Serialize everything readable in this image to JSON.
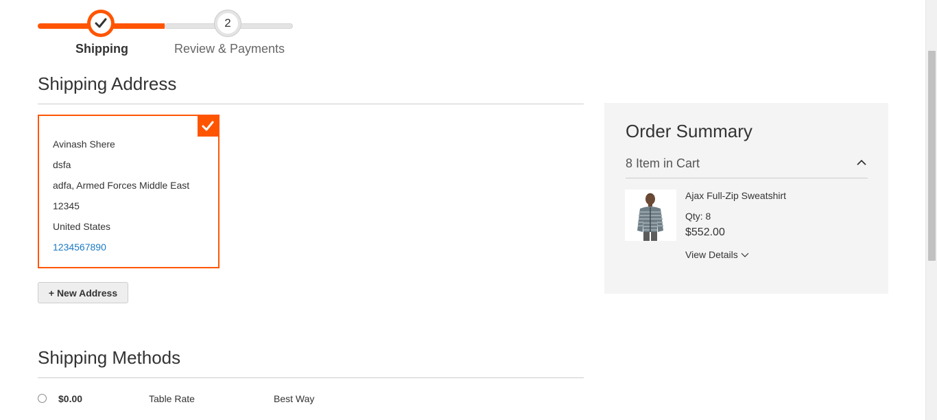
{
  "progress": {
    "steps": [
      {
        "number": "1",
        "label": "Shipping",
        "state": "complete"
      },
      {
        "number": "2",
        "label": "Review & Payments",
        "state": "pending"
      }
    ],
    "active_color": "#ff5501",
    "check_icon": "checkmark-icon"
  },
  "shipping_address": {
    "title": "Shipping Address",
    "selected_address": {
      "lines": [
        "Avinash Shere",
        "dsfa",
        "adfa, Armed Forces Middle East",
        "12345",
        "United States"
      ],
      "phone": "1234567890",
      "badge_icon": "checkmark-icon"
    },
    "new_address_button": "+ New Address"
  },
  "shipping_methods": {
    "title": "Shipping Methods",
    "options": [
      {
        "price": "$0.00",
        "carrier": "Table Rate",
        "method": "Best Way",
        "selected": false
      }
    ]
  },
  "order_summary": {
    "title": "Order Summary",
    "items_in_cart": "8 Item in Cart",
    "toggle_icon": "chevron-up-icon",
    "items": [
      {
        "name": "Ajax Full-Zip Sweatshirt",
        "qty": "Qty: 8",
        "price": "$552.00",
        "view_details": "View Details",
        "thumbnail": "product-thumbnail"
      }
    ]
  }
}
